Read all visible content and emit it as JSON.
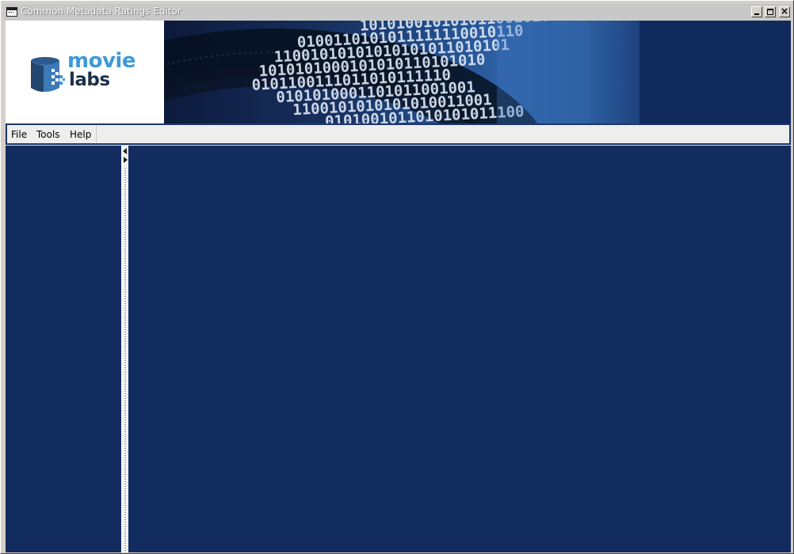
{
  "window": {
    "title": "Common Metadata Ratings Editor"
  },
  "banner": {
    "logo_top": "movie",
    "logo_bottom": "labs",
    "brand_colors": {
      "movie": "#3d9ad8",
      "labs": "#1e2f4a",
      "background": "#112a5e"
    },
    "binary_rows": [
      "1010100101010110010101",
      "0100110101011111110010110",
      "11001010101010101011010101",
      "1010101000101010110101010",
      "0101100111011010111110",
      "0101010001101011001001",
      "1100101010101010011001",
      "0101001011010101011100"
    ]
  },
  "menubar": {
    "items": [
      {
        "label": "File"
      },
      {
        "label": "Tools"
      },
      {
        "label": "Help"
      }
    ]
  },
  "colors": {
    "pane_background": "#132c60",
    "menubar_border": "#1d3768"
  },
  "icons": {
    "app": "window-app-icon",
    "minimize": "minimize-icon",
    "maximize": "maximize-icon",
    "close": "close-icon",
    "collapse_left": "collapse-left-arrow-icon",
    "expand_right": "expand-right-arrow-icon"
  }
}
